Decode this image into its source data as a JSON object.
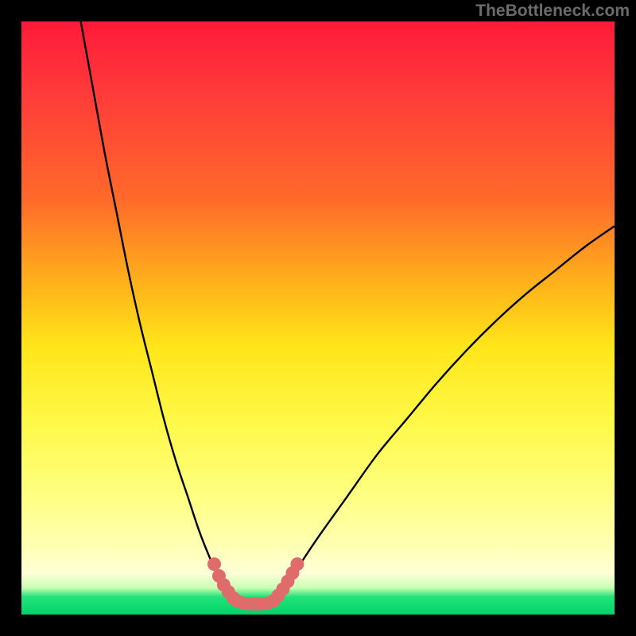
{
  "attribution": "TheBottleneck.com",
  "colors": {
    "frame": "#000000",
    "gradient_top": "#ff1a3a",
    "gradient_bottom": "#00d46a",
    "curve": "#000000",
    "marker": "#e06b6b"
  },
  "chart_data": {
    "type": "line",
    "title": "",
    "xlabel": "",
    "ylabel": "",
    "xlim": [
      0,
      100
    ],
    "ylim": [
      0,
      100
    ],
    "series": [
      {
        "name": "left-curve",
        "x": [
          10,
          12,
          14,
          16,
          18,
          20,
          22,
          24,
          26,
          28,
          30,
          32,
          33,
          34,
          35,
          36,
          37
        ],
        "values": [
          100,
          89,
          78,
          68,
          58,
          49,
          41,
          33,
          26,
          20,
          14,
          9,
          7,
          5,
          3.5,
          2.5,
          2
        ]
      },
      {
        "name": "right-curve",
        "x": [
          42,
          43,
          44,
          45,
          47,
          50,
          55,
          60,
          65,
          70,
          75,
          80,
          85,
          90,
          95,
          100
        ],
        "values": [
          2,
          3,
          4,
          5.5,
          8.5,
          13,
          20,
          27,
          33,
          39,
          44.5,
          49.5,
          54,
          58,
          62,
          65.5
        ]
      },
      {
        "name": "valley-floor",
        "x": [
          37,
          38,
          39,
          40,
          41,
          42
        ],
        "values": [
          2,
          1.8,
          1.8,
          1.8,
          1.8,
          2
        ]
      }
    ],
    "markers": [
      {
        "x": 32.5,
        "y": 8.5
      },
      {
        "x": 33.3,
        "y": 6.5
      },
      {
        "x": 34.1,
        "y": 5.0
      },
      {
        "x": 34.9,
        "y": 3.8
      },
      {
        "x": 35.7,
        "y": 2.8
      },
      {
        "x": 36.5,
        "y": 2.2
      },
      {
        "x": 37.5,
        "y": 1.9
      },
      {
        "x": 38.5,
        "y": 1.8
      },
      {
        "x": 39.5,
        "y": 1.8
      },
      {
        "x": 40.5,
        "y": 1.8
      },
      {
        "x": 41.5,
        "y": 1.9
      },
      {
        "x": 42.5,
        "y": 2.3
      },
      {
        "x": 43.3,
        "y": 3.2
      },
      {
        "x": 44.1,
        "y": 4.3
      },
      {
        "x": 44.9,
        "y": 5.6
      },
      {
        "x": 45.7,
        "y": 7.0
      },
      {
        "x": 46.5,
        "y": 8.5
      }
    ]
  }
}
